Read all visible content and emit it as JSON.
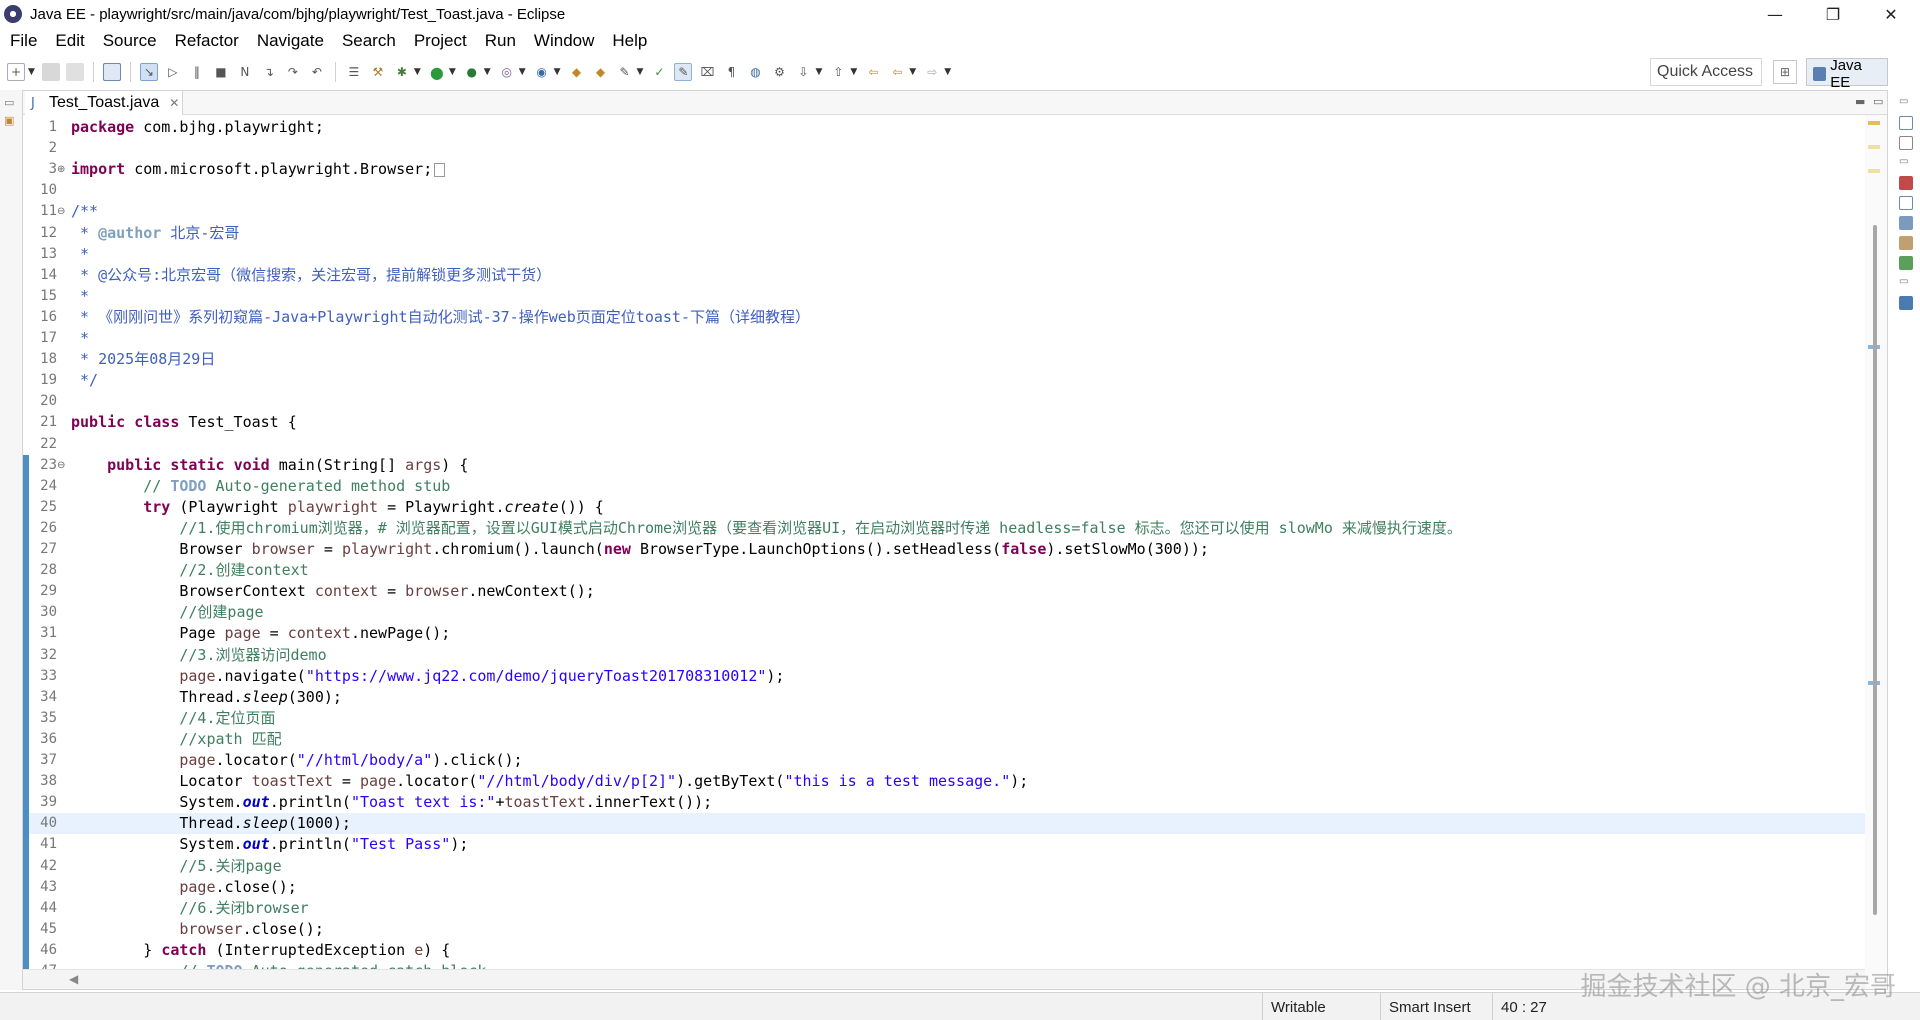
{
  "window": {
    "title": "Java EE - playwright/src/main/java/com/bjhg/playwright/Test_Toast.java - Eclipse",
    "minimize": "—",
    "restore": "❐",
    "close": "✕"
  },
  "menu": [
    "File",
    "Edit",
    "Source",
    "Refactor",
    "Navigate",
    "Search",
    "Project",
    "Run",
    "Window",
    "Help"
  ],
  "toolbar": {
    "quick_access": "Quick Access",
    "perspective": "Java EE"
  },
  "editor": {
    "tab_label": "Test_Toast.java",
    "lines": [
      {
        "n": "1",
        "html": "<span class=\"kw\">package</span> com.bjhg.playwright;"
      },
      {
        "n": "2",
        "html": ""
      },
      {
        "n": "3",
        "html": "<span class=\"kw\">import</span> com.microsoft.playwright.Browser;<span class=\"fold-box\"></span>",
        "marker": "⊕",
        "warn": true
      },
      {
        "n": "10",
        "html": ""
      },
      {
        "n": "11",
        "html": "<span class=\"jd\">/**</span>",
        "marker": "⊖"
      },
      {
        "n": "12",
        "html": "<span class=\"jd\"> * </span><span class=\"jdtag\">@author</span><span class=\"jd\"> 北京-宏哥</span>"
      },
      {
        "n": "13",
        "html": "<span class=\"jd\"> *</span>"
      },
      {
        "n": "14",
        "html": "<span class=\"jd\"> * @公众号:北京宏哥（微信搜索，关注宏哥，提前解锁更多测试干货）</span>"
      },
      {
        "n": "15",
        "html": "<span class=\"jd\"> *</span>"
      },
      {
        "n": "16",
        "html": "<span class=\"jd\"> * 《刚刚问世》系列初窥篇-Java+Playwright自动化测试-37-操作web页面定位toast-下篇（详细教程）</span>"
      },
      {
        "n": "17",
        "html": "<span class=\"jd\"> *</span>"
      },
      {
        "n": "18",
        "html": "<span class=\"jd\"> * 2025年08月29日</span>"
      },
      {
        "n": "19",
        "html": "<span class=\"jd\"> */</span>"
      },
      {
        "n": "20",
        "html": ""
      },
      {
        "n": "21",
        "html": "<span class=\"kw\">public</span> <span class=\"kw\">class</span> Test_Toast {"
      },
      {
        "n": "22",
        "html": ""
      },
      {
        "n": "23",
        "html": "    <span class=\"kw\">public</span> <span class=\"kw\">static</span> <span class=\"kw\">void</span> main(String[] <span class=\"var\">args</span>) {",
        "marker": "⊖"
      },
      {
        "n": "24",
        "html": "        <span class=\"cm\">// </span><span class=\"todo\">TODO</span><span class=\"cm\"> Auto-generated method stub</span>"
      },
      {
        "n": "25",
        "html": "        <span class=\"kw\">try</span> (Playwright <span class=\"var\">playwright</span> = Playwright.<span class=\"st\">create</span>()) {"
      },
      {
        "n": "26",
        "html": "            <span class=\"cm\">//1.使用chromium浏览器，# 浏览器配置，设置以GUI模式启动Chrome浏览器（要查看浏览器UI，在启动浏览器时传递 headless=false 标志。您还可以使用 slowMo 来减慢执行速度。</span>"
      },
      {
        "n": "27",
        "html": "            Browser <span class=\"var\">browser</span> = <span class=\"var\">playwright</span>.chromium().launch(<span class=\"kw\">new</span> BrowserType.LaunchOptions().setHeadless(<span class=\"kw\">false</span>).setSlowMo(300));"
      },
      {
        "n": "28",
        "html": "            <span class=\"cm\">//2.创建context</span>"
      },
      {
        "n": "29",
        "html": "            BrowserContext <span class=\"var\">context</span> = <span class=\"var\">browser</span>.newContext();"
      },
      {
        "n": "30",
        "html": "            <span class=\"cm\">//创建page</span>"
      },
      {
        "n": "31",
        "html": "            Page <span class=\"var\">page</span> = <span class=\"var\">context</span>.newPage();"
      },
      {
        "n": "32",
        "html": "            <span class=\"cm\">//3.浏览器访问demo</span>"
      },
      {
        "n": "33",
        "html": "            <span class=\"var\">page</span>.navigate(<span class=\"str\">\"https://www.jq22.com/demo/jqueryToast201708310012\"</span>);"
      },
      {
        "n": "34",
        "html": "            Thread.<span class=\"st\">sleep</span>(300);"
      },
      {
        "n": "35",
        "html": "            <span class=\"cm\">//4.定位页面</span>"
      },
      {
        "n": "36",
        "html": "            <span class=\"cm\">//xpath 匹配</span>"
      },
      {
        "n": "37",
        "html": "            <span class=\"var\">page</span>.locator(<span class=\"str\">\"//html/body/a\"</span>).click();"
      },
      {
        "n": "38",
        "html": "            Locator <span class=\"var\">toastText</span> = <span class=\"var\">page</span>.locator(<span class=\"str\">\"//html/body/div/p[2]\"</span>).getByText(<span class=\"str\">\"this is a test message.\"</span>);"
      },
      {
        "n": "39",
        "html": "            System.<span class=\"fld\">out</span>.println(<span class=\"str\">\"Toast text is:\"</span>+<span class=\"var\">toastText</span>.innerText());"
      },
      {
        "n": "40",
        "html": "            Thread.<span class=\"st\">sleep</span>(1000);",
        "current": true
      },
      {
        "n": "41",
        "html": "            System.<span class=\"fld\">out</span>.println(<span class=\"str\">\"Test Pass\"</span>);"
      },
      {
        "n": "42",
        "html": "            <span class=\"cm\">//5.关闭page</span>"
      },
      {
        "n": "43",
        "html": "            <span class=\"var\">page</span>.close();"
      },
      {
        "n": "44",
        "html": "            <span class=\"cm\">//6.关闭browser</span>"
      },
      {
        "n": "45",
        "html": "            <span class=\"var\">browser</span>.close();"
      },
      {
        "n": "46",
        "html": "        } <span class=\"kw\">catch</span> (InterruptedException <span class=\"var\">e</span>) {"
      },
      {
        "n": "47",
        "html": "            <span class=\"cm\">// </span><span class=\"todo\">TODO</span><span class=\"cm\"> Auto-generated catch block</span>"
      }
    ]
  },
  "status": {
    "writable": "Writable",
    "insert_mode": "Smart Insert",
    "position": "40 : 27"
  },
  "watermark": "掘金技术社区 @ 北京_宏哥",
  "colors": {
    "keyword": "#7f0055",
    "comment": "#3f7f5f",
    "javadoc": "#3f5fbf",
    "string": "#2a00ff",
    "current_line": "#e8f2fe"
  }
}
